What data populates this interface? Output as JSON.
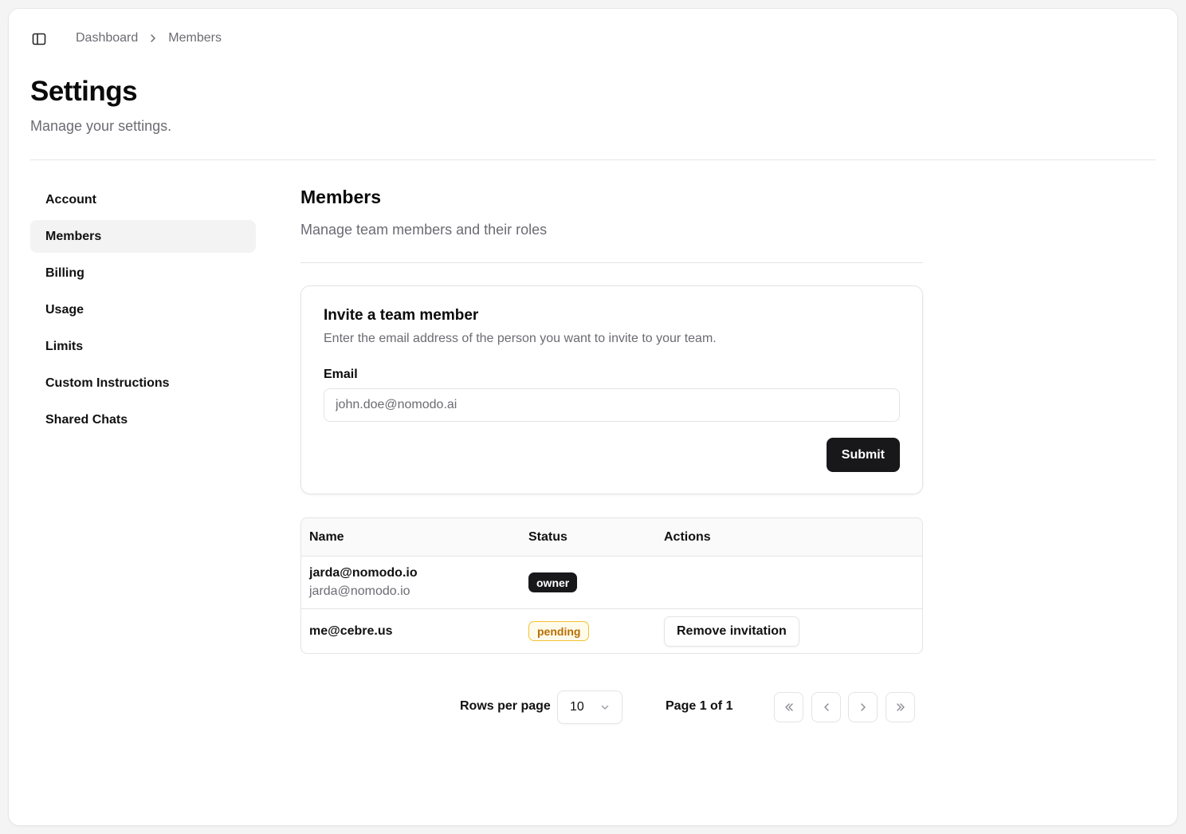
{
  "breadcrumb": {
    "items": [
      "Dashboard",
      "Members"
    ]
  },
  "page": {
    "title": "Settings",
    "subtitle": "Manage your settings."
  },
  "sidebar": {
    "active": "Members",
    "items": [
      {
        "label": "Account"
      },
      {
        "label": "Members"
      },
      {
        "label": "Billing"
      },
      {
        "label": "Usage"
      },
      {
        "label": "Limits"
      },
      {
        "label": "Custom Instructions"
      },
      {
        "label": "Shared Chats"
      }
    ]
  },
  "section": {
    "title": "Members",
    "subtitle": "Manage team members and their roles"
  },
  "invite": {
    "title": "Invite a team member",
    "description": "Enter the email address of the person you want to invite to your team.",
    "email_label": "Email",
    "email_placeholder": "john.doe@nomodo.ai",
    "email_value": "",
    "submit_label": "Submit"
  },
  "table": {
    "columns": [
      "Name",
      "Status",
      "Actions"
    ],
    "rows": [
      {
        "name": "jarda@nomodo.io",
        "email": "jarda@nomodo.io",
        "status": "owner",
        "action": ""
      },
      {
        "name": "me@cebre.us",
        "email": "",
        "status": "pending",
        "action": "Remove invitation"
      }
    ]
  },
  "pagination": {
    "rows_per_page_label": "Rows per page",
    "rows_per_page_value": "10",
    "page_indicator": "Page 1 of 1"
  },
  "colors": {
    "primary": "#18181b",
    "muted_text": "#6b6b73",
    "border": "#e4e4e7",
    "pending_text": "#b76e00",
    "pending_border": "#f1c232"
  },
  "icons": [
    "sidebar-panel-icon",
    "chevron-right-icon",
    "chevron-down-icon",
    "chevrons-left-icon",
    "chevron-left-icon",
    "chevron-right-icon",
    "chevrons-right-icon"
  ]
}
